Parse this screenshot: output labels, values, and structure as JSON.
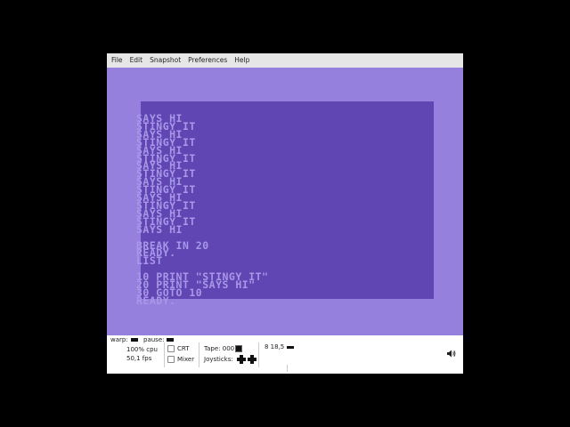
{
  "menubar": {
    "items": [
      "File",
      "Edit",
      "Snapshot",
      "Preferences",
      "Help"
    ]
  },
  "c64": {
    "screen_text": "SAYS HI\nSTINGY IT\nSAYS HI\nSTINGY IT\nSAYS HI\nSTINGY IT\nSAYS HI\nSTINGY IT\nSAYS HI\nSTINGY IT\nSAYS HI\nSTINGY IT\nSAYS HI\nSTINGY IT\nSAYS HI\n\nBREAK IN 20\nREADY.\nLIST\n\n10 PRINT \"STINGY IT\"\n20 PRINT \"SAYS HI\"\n30 GOTO 10\nREADY.",
    "border_color": "#9580de",
    "screen_color": "#5f46b3",
    "text_color": "#a898e8"
  },
  "status": {
    "warp_label": "warp:",
    "pause_label": "pause:",
    "cpu": "100% cpu",
    "fps": "50,1 fps",
    "crt_label": "CRT",
    "mixer_label": "Mixer",
    "tape_label": "Tape:",
    "tape_counter": "000",
    "joysticks_label": "Joysticks:",
    "drive_info": "8 18,5"
  },
  "icons": {
    "volume": "speaker-icon",
    "joystick": "joystick-icon"
  }
}
